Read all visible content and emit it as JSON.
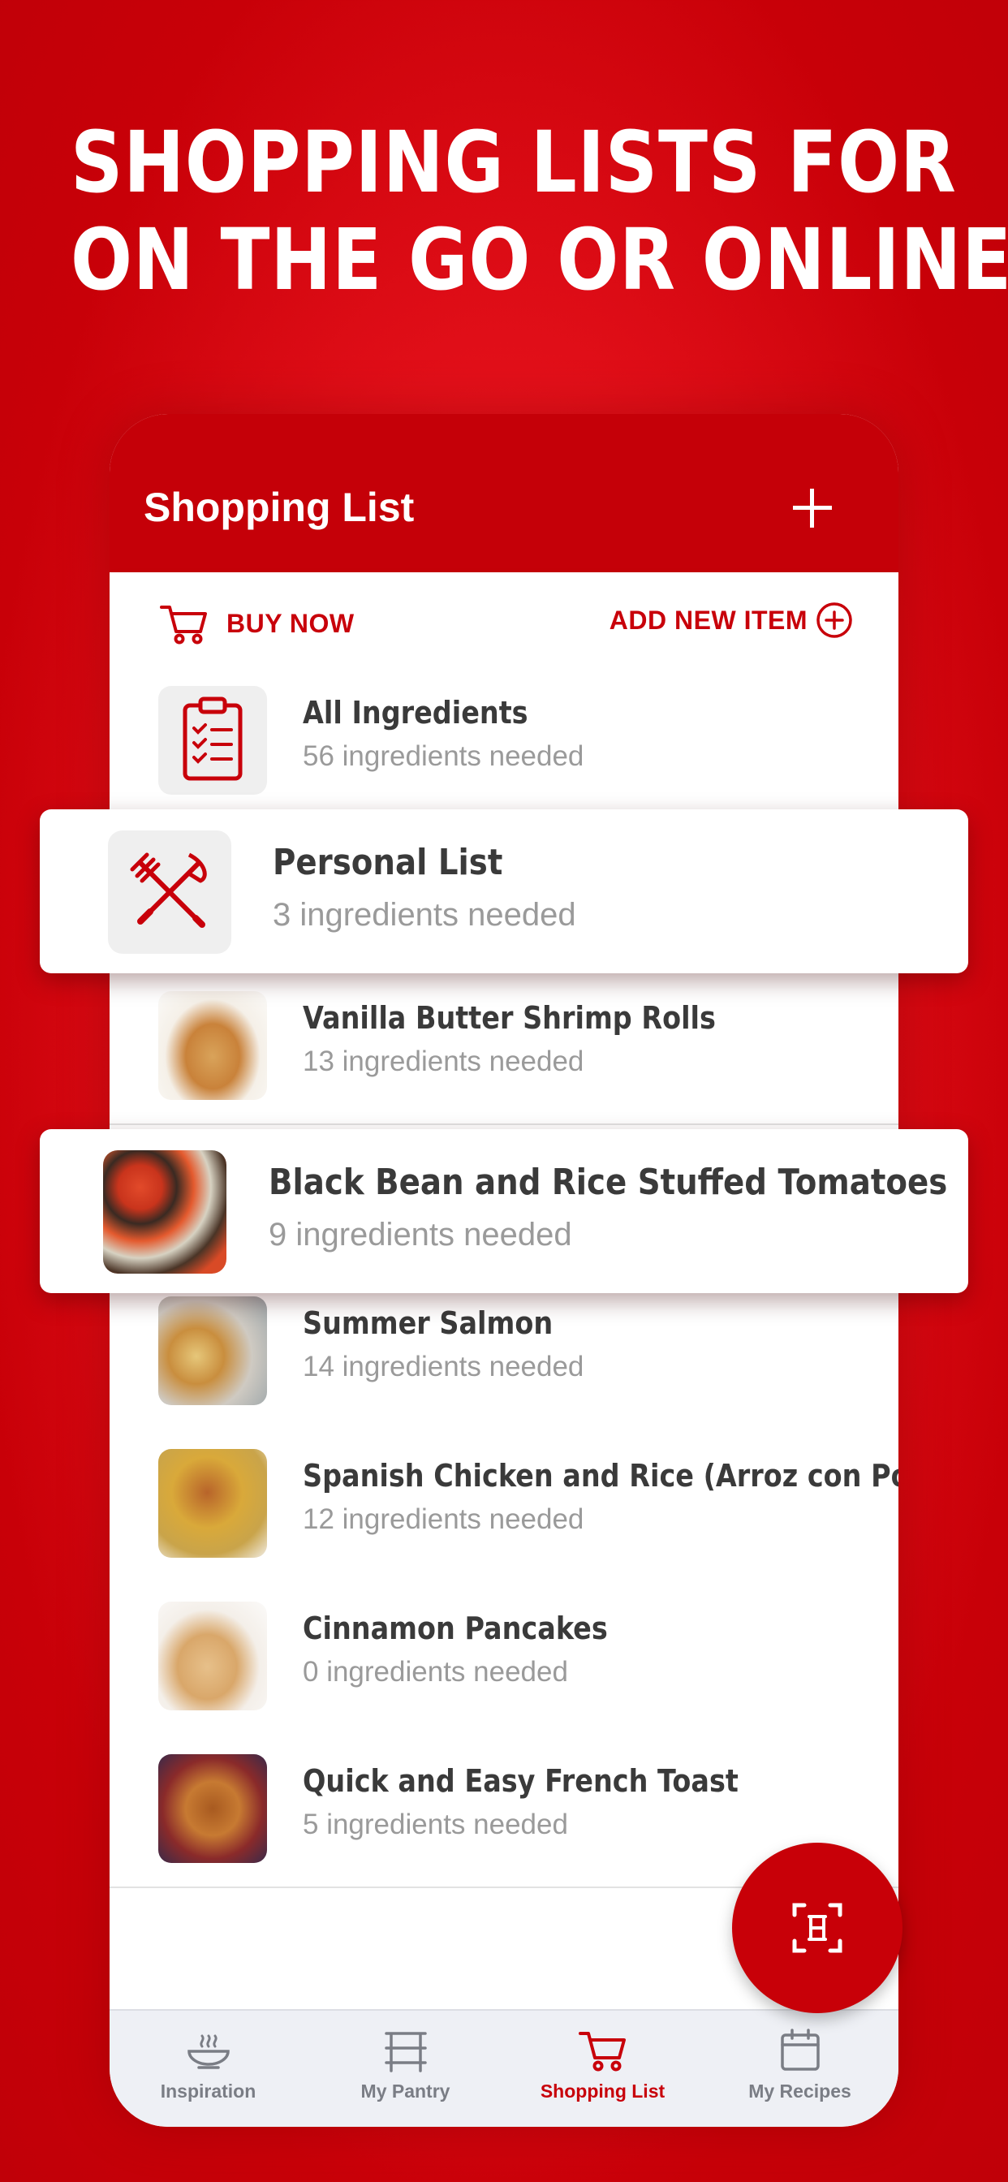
{
  "headline": {
    "line1": "SHOPPING LISTS FOR",
    "line2": "ON THE GO OR ONLINE"
  },
  "header": {
    "title": "Shopping List"
  },
  "actions": {
    "buy_now": "BUY NOW",
    "add_new_item": "ADD NEW ITEM"
  },
  "lists": [
    {
      "title": "All Ingredients",
      "subtitle": "56 ingredients needed"
    },
    {
      "title": "Personal List",
      "subtitle": "3 ingredients needed"
    },
    {
      "title": "Vanilla Butter Shrimp Rolls",
      "subtitle": "13 ingredients needed"
    },
    {
      "title": "Black Bean and Rice Stuffed Tomatoes",
      "subtitle": "9 ingredients needed"
    },
    {
      "title": "Summer Salmon",
      "subtitle": "14 ingredients needed"
    },
    {
      "title": "Spanish Chicken and Rice (Arroz con Pollo)",
      "subtitle": "12 ingredients needed"
    },
    {
      "title": "Cinnamon Pancakes",
      "subtitle": "0 ingredients needed"
    },
    {
      "title": "Quick and Easy French Toast",
      "subtitle": "5 ingredients needed"
    }
  ],
  "tabs": [
    {
      "label": "Inspiration",
      "icon": "bowl-icon",
      "active": false
    },
    {
      "label": "My Pantry",
      "icon": "shelf-icon",
      "active": false
    },
    {
      "label": "Shopping List",
      "icon": "cart-icon",
      "active": true
    },
    {
      "label": "My Recipes",
      "icon": "calendar-icon",
      "active": false
    }
  ],
  "colors": {
    "brand_red": "#c50008",
    "muted_text": "#9a9a9a",
    "tab_inactive": "#7a7d85"
  }
}
